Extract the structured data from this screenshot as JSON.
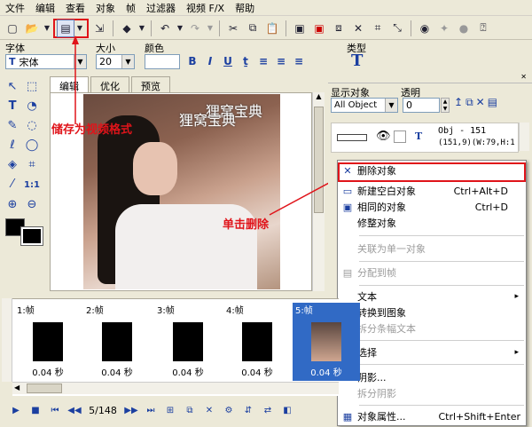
{
  "menubar": [
    "文件",
    "编辑",
    "查看",
    "对象",
    "帧",
    "过滤器",
    "视频 F/X",
    "帮助"
  ],
  "format": {
    "font_label": "字体",
    "size_label": "大小",
    "color_label": "颜色",
    "type_label": "类型",
    "font_value": "宋体",
    "size_value": "20",
    "font_prefix": "T"
  },
  "tabs": [
    "编辑",
    "优化",
    "预览"
  ],
  "watermark": {
    "line1": "狸窝宝典",
    "line2": "狸窝宝典"
  },
  "annotations": {
    "save_note": "储存为视频格式",
    "delete_note": "单击删除"
  },
  "right_panel": {
    "show_objects_label": "显示对象",
    "transparency_label": "透明",
    "show_objects_value": "All Object",
    "transparency_value": "0",
    "obj_name": "Obj - 151",
    "obj_info": "(151,9)(W:79,H:1",
    "t_label": "T"
  },
  "context_menu": [
    {
      "icon": "✕",
      "label": "删除对象",
      "shortcut": "",
      "disabled": false
    },
    {
      "icon": "▭",
      "label": "新建空白对象",
      "shortcut": "Ctrl+Alt+D",
      "disabled": false
    },
    {
      "icon": "▣",
      "label": "相同的对象",
      "shortcut": "Ctrl+D",
      "disabled": false
    },
    {
      "icon": "",
      "label": "修整对象",
      "shortcut": "",
      "disabled": false
    },
    {
      "icon": "",
      "label": "关联为单一对象",
      "shortcut": "",
      "disabled": true
    },
    {
      "icon": "▤",
      "label": "分配到帧",
      "shortcut": "",
      "disabled": true
    },
    {
      "icon": "",
      "label": "文本",
      "shortcut": "▸",
      "disabled": false
    },
    {
      "icon": "",
      "label": "转换到图象",
      "shortcut": "",
      "disabled": false
    },
    {
      "icon": "",
      "label": "拆分条幅文本",
      "shortcut": "",
      "disabled": true
    },
    {
      "icon": "",
      "label": "选择",
      "shortcut": "▸",
      "disabled": false
    },
    {
      "icon": "",
      "label": "阴影...",
      "shortcut": "",
      "disabled": false
    },
    {
      "icon": "",
      "label": "拆分阴影",
      "shortcut": "",
      "disabled": true
    },
    {
      "icon": "▦",
      "label": "对象属性...",
      "shortcut": "Ctrl+Shift+Enter",
      "disabled": false
    }
  ],
  "frames": [
    {
      "label": "1:帧",
      "time": "0.04 秒"
    },
    {
      "label": "2:帧",
      "time": "0.04 秒"
    },
    {
      "label": "3:帧",
      "time": "0.04 秒"
    },
    {
      "label": "4:帧",
      "time": "0.04 秒"
    },
    {
      "label": "5:帧",
      "time": "0.04 秒"
    }
  ],
  "playbar": {
    "counter": "5/148"
  },
  "colors": {
    "annotation_red": "#e0141a",
    "selection_blue": "#316ac5",
    "accent_blue": "#1b3fa0"
  }
}
